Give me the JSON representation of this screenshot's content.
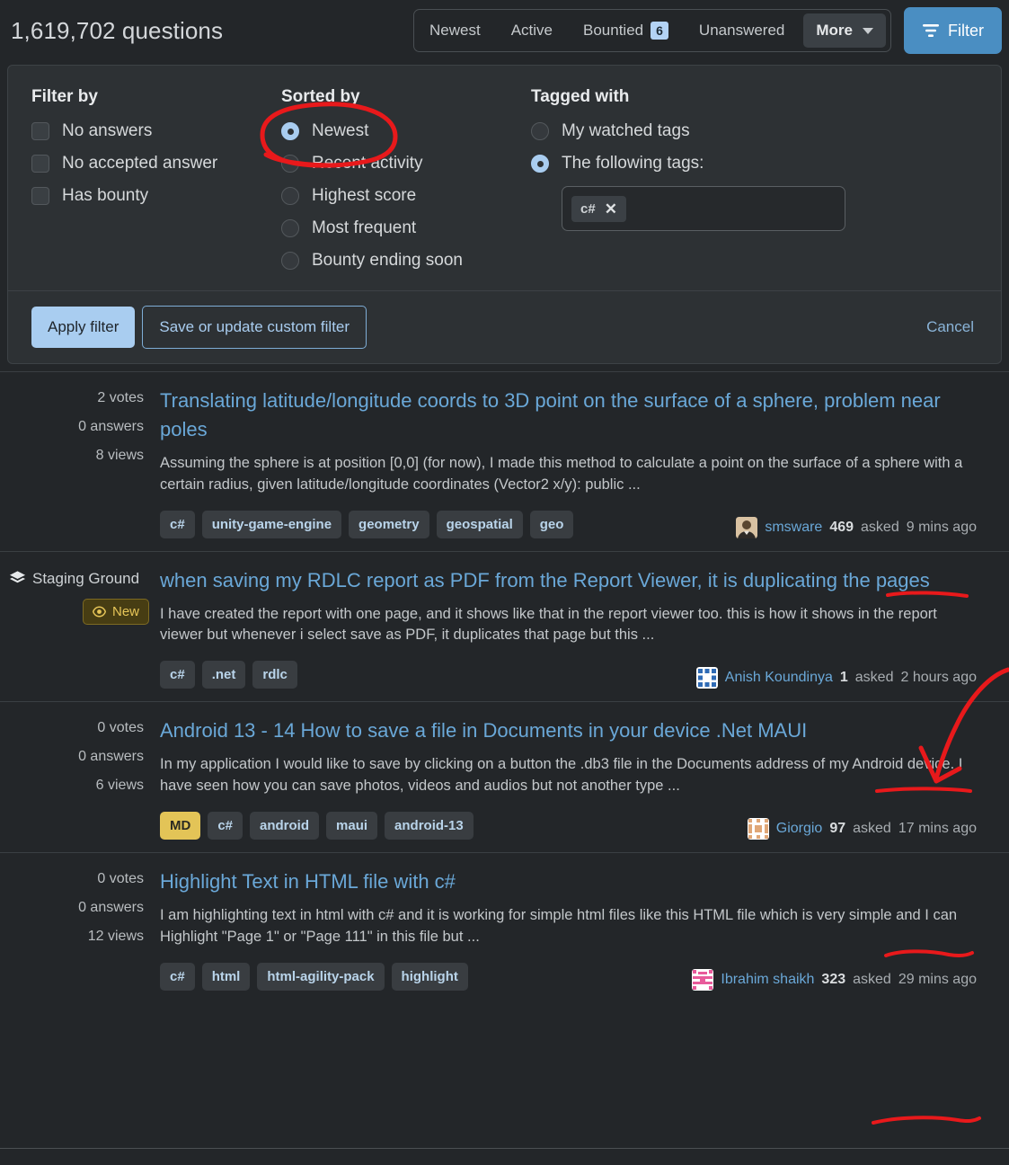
{
  "header": {
    "question_count": "1,619,702 questions",
    "tabs": [
      {
        "label": "Newest",
        "badge": null
      },
      {
        "label": "Active",
        "badge": null
      },
      {
        "label": "Bountied",
        "badge": "6"
      },
      {
        "label": "Unanswered",
        "badge": null
      }
    ],
    "more_label": "More",
    "filter_label": "Filter",
    "filter_icon": "funnel-icon",
    "more_icon": "chevron-down-icon",
    "accent_blue": "#4a8ec2"
  },
  "filter_panel": {
    "filter_by": {
      "title": "Filter by",
      "options": [
        {
          "label": "No answers",
          "checked": false
        },
        {
          "label": "No accepted answer",
          "checked": false
        },
        {
          "label": "Has bounty",
          "checked": false
        }
      ]
    },
    "sorted_by": {
      "title": "Sorted by",
      "options": [
        {
          "label": "Newest",
          "checked": true
        },
        {
          "label": "Recent activity",
          "checked": false
        },
        {
          "label": "Highest score",
          "checked": false
        },
        {
          "label": "Most frequent",
          "checked": false
        },
        {
          "label": "Bounty ending soon",
          "checked": false
        }
      ]
    },
    "tagged_with": {
      "title": "Tagged with",
      "options": [
        {
          "label": "My watched tags",
          "checked": false
        },
        {
          "label": "The following tags:",
          "checked": true
        }
      ],
      "tags": [
        {
          "label": "c#",
          "remove_icon": "close-icon"
        }
      ],
      "input_placeholder": ""
    },
    "actions": {
      "apply_label": "Apply filter",
      "save_label": "Save or update custom filter",
      "cancel_label": "Cancel"
    }
  },
  "questions": [
    {
      "votes": "2 votes",
      "answers": "0 answers",
      "views": "8 views",
      "staging_ground": null,
      "title": "Translating latitude/longitude coords to 3D point on the surface of a sphere, problem near poles",
      "excerpt": "Assuming the sphere is at position [0,0] (for now), I made this method to calculate a point on the surface of a sphere with a certain radius, given latitude/longitude coordinates (Vector2 x/y): public ...",
      "tags": [
        {
          "label": "c#",
          "style": "normal"
        },
        {
          "label": "unity-game-engine",
          "style": "normal"
        },
        {
          "label": "geometry",
          "style": "normal"
        },
        {
          "label": "geospatial",
          "style": "normal"
        },
        {
          "label": "geo",
          "style": "normal"
        }
      ],
      "user": {
        "name": "smsware",
        "reputation": "469",
        "asked_label": "asked",
        "time": "9 mins ago",
        "avatar_color": "#8a6a3e"
      }
    },
    {
      "votes": null,
      "answers": null,
      "views": null,
      "staging_ground": {
        "label": "Staging Ground",
        "icon": "layers-icon",
        "badge": {
          "label": "New",
          "icon": "eye-icon"
        }
      },
      "title": "when saving my RDLC report as PDF from the Report Viewer, it is duplicating the pages",
      "excerpt": "I have created the report with one page, and it shows like that in the report viewer too. this is how it shows in the report viewer but whenever i select save as PDF, it duplicates that page but this ...",
      "tags": [
        {
          "label": "c#",
          "style": "normal"
        },
        {
          "label": ".net",
          "style": "normal"
        },
        {
          "label": "rdlc",
          "style": "normal"
        }
      ],
      "user": {
        "name": "Anish Koundinya",
        "reputation": "1",
        "asked_label": "asked",
        "time": "2 hours ago",
        "avatar_color": "#3c6fb0"
      }
    },
    {
      "votes": "0 votes",
      "answers": "0 answers",
      "views": "6 views",
      "staging_ground": null,
      "title": "Android 13 - 14 How to save a file in Documents in your device .Net MAUI",
      "excerpt": "In my application I would like to save by clicking on a button the .db3 file in the Documents address of my Android device. I have seen how you can save photos, videos and audios but not another type ...",
      "tags": [
        {
          "label": "MD",
          "style": "md"
        },
        {
          "label": "c#",
          "style": "normal"
        },
        {
          "label": "android",
          "style": "normal"
        },
        {
          "label": "maui",
          "style": "normal"
        },
        {
          "label": "android-13",
          "style": "normal"
        }
      ],
      "user": {
        "name": "Giorgio",
        "reputation": "97",
        "asked_label": "asked",
        "time": "17 mins ago",
        "avatar_color": "#e0a777"
      }
    },
    {
      "votes": "0 votes",
      "answers": "0 answers",
      "views": "12 views",
      "staging_ground": null,
      "title": "Highlight Text in HTML file with c#",
      "excerpt": "I am highlighting text in html with c# and it is working for simple html files like this HTML file which is very simple and I can Highlight \"Page 1\" or \"Page 111\" in this file but ...",
      "tags": [
        {
          "label": "c#",
          "style": "normal"
        },
        {
          "label": "html",
          "style": "normal"
        },
        {
          "label": "html-agility-pack",
          "style": "normal"
        },
        {
          "label": "highlight",
          "style": "normal"
        }
      ],
      "user": {
        "name": "Ibrahim shaikh",
        "reputation": "323",
        "asked_label": "asked",
        "time": "29 mins ago",
        "avatar_color": "#e85b9b"
      }
    }
  ],
  "annotations": {
    "color": "#e8191b",
    "items": [
      {
        "name": "ellipse-around-newest-radio"
      },
      {
        "name": "underline-9-mins-ago"
      },
      {
        "name": "arrow-to-2-hours-ago"
      },
      {
        "name": "underline-2-hours-ago"
      },
      {
        "name": "underline-17-mins-ago"
      },
      {
        "name": "underline-29-mins-ago"
      }
    ]
  }
}
